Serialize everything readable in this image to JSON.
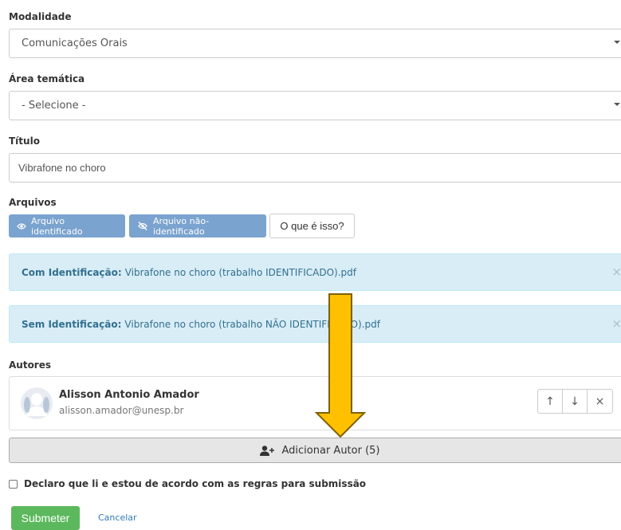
{
  "form": {
    "modalidade": {
      "label": "Modalidade",
      "value": "Comunicações Orais"
    },
    "area": {
      "label": "Área temática",
      "value": "- Selecione -"
    },
    "titulo": {
      "label": "Título",
      "value": "Vibrafone no choro"
    },
    "arquivos": {
      "label": "Arquivos",
      "btn_identificado": "Arquivo identificado",
      "btn_nao_identificado": "Arquivo não-identificado",
      "btn_help": "O que é isso?"
    },
    "alerts": [
      {
        "prefix": "Com Identificação:",
        "text": "Vibrafone no choro (trabalho IDENTIFICADO).pdf",
        "close": "×"
      },
      {
        "prefix": "Sem Identificação:",
        "text": "Vibrafone no choro (trabalho NÃO IDENTIFICADO).pdf",
        "close": "×"
      }
    ],
    "autores": {
      "label": "Autores",
      "list": [
        {
          "name": "Alisson Antonio Amador",
          "email": "alisson.amador@unesp.br"
        }
      ],
      "move_up": "↑",
      "move_down": "↓",
      "remove": "×",
      "add_button": "Adicionar Autor (5)"
    },
    "declaro": "Declaro que li e estou de acordo com as regras para submissão",
    "submit": "Submeter",
    "cancel": "Cancelar"
  },
  "colors": {
    "primary_file_button": "#7ba3cf",
    "alert_bg": "#d9edf7",
    "alert_text": "#31708f",
    "submit_green": "#5cb85c",
    "arrow_fill": "#ffc000",
    "arrow_stroke": "#7f6000"
  },
  "icons": {
    "eye": "eye-icon",
    "eye_slash": "eye-slash-icon",
    "user_plus": "user-plus-icon",
    "avatar": "avatar-placeholder-icon",
    "annotation_arrow": "down-arrow-annotation-icon"
  }
}
